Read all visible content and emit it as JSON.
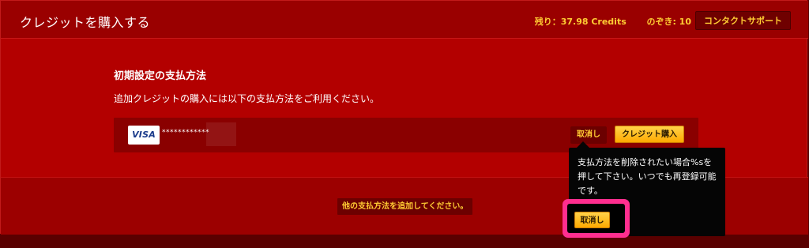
{
  "header": {
    "title": "クレジットを購入する",
    "credits_label": "残り：37.98 Credits",
    "peek_label": "のぞき: 10",
    "contact_label": "コンタクトサポート"
  },
  "payment": {
    "section_title": "初期設定の支払方法",
    "section_subtitle": "追加クレジットの購入には以下の支払方法をご利用ください。",
    "card_brand": "VISA",
    "masked_number": "************",
    "cancel_label": "取消し",
    "buy_label": "クレジット購入",
    "add_method_label": "他の支払方法を追加してください。"
  },
  "tooltip": {
    "message": "支払方法を削除されたい場合%sを押して下さい。いつでも再登録可能です。",
    "confirm_label": "取消し"
  },
  "colors": {
    "page_bg": "#5a0000",
    "panel_bg": "#b30000",
    "header_bg": "#9a0000",
    "accent": "#ffcc33",
    "button_orange": "#ffb300",
    "highlight_pink": "#ff2e8f"
  }
}
